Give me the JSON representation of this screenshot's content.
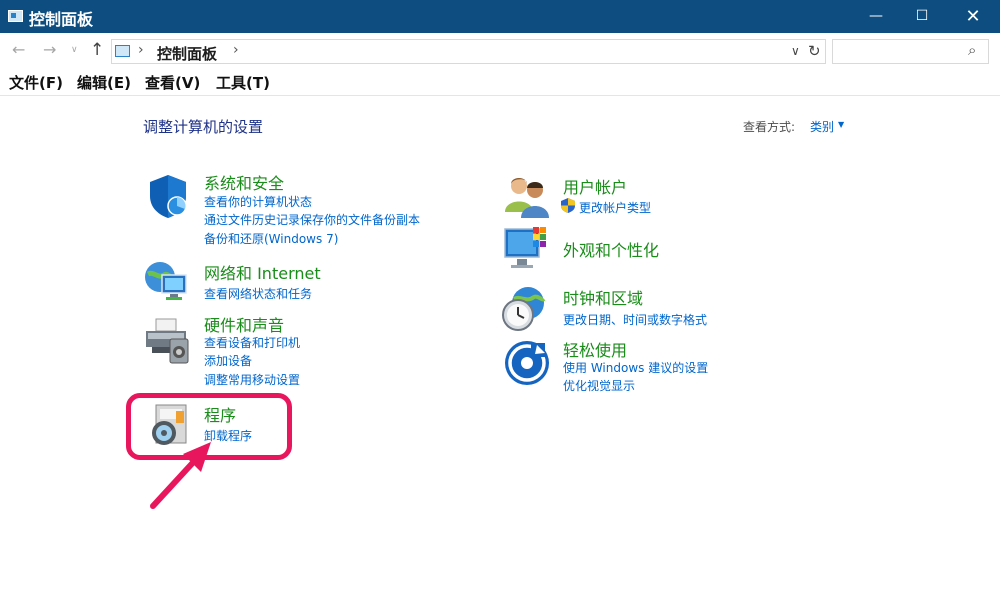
{
  "window": {
    "title": "控制面板"
  },
  "controls": {
    "minimize": "—",
    "maximize": "☐",
    "close": "✕"
  },
  "nav": {
    "back": "←",
    "forward": "→",
    "dropdown": "∨",
    "up": "↑"
  },
  "address": {
    "separator": "›",
    "crumb": "控制面板",
    "dropdown": "∨",
    "refresh": "↻"
  },
  "search": {
    "placeholder": "",
    "icon": "⌕"
  },
  "menu": [
    "文件(F)",
    "编辑(E)",
    "查看(V)",
    "工具(T)"
  ],
  "content": {
    "heading": "调整计算机的设置",
    "viewby_label": "查看方式:",
    "viewby_value": "类别",
    "viewby_caret": "▼"
  },
  "categories": {
    "system": {
      "title": "系统和安全",
      "icon": "shield-icon",
      "links": [
        "查看你的计算机状态",
        "通过文件历史记录保存你的文件备份副本",
        "备份和还原(Windows 7)"
      ]
    },
    "network": {
      "title": "网络和 Internet",
      "icon": "globe-network-icon",
      "links": [
        "查看网络状态和任务"
      ]
    },
    "hardware": {
      "title": "硬件和声音",
      "icon": "printer-icon",
      "links": [
        "查看设备和打印机",
        "添加设备",
        "调整常用移动设置"
      ]
    },
    "programs": {
      "title": "程序",
      "icon": "programs-disc-icon",
      "links": [
        "卸载程序"
      ]
    },
    "users": {
      "title": "用户帐户",
      "icon": "users-icon",
      "links": [
        "更改帐户类型"
      ]
    },
    "appearance": {
      "title": "外观和个性化",
      "icon": "monitor-palette-icon",
      "links": []
    },
    "clock": {
      "title": "时钟和区域",
      "icon": "clock-globe-icon",
      "links": [
        "更改日期、时间或数字格式"
      ]
    },
    "ease": {
      "title": "轻松使用",
      "icon": "ease-of-access-icon",
      "links": [
        "使用 Windows 建议的设置",
        "优化视觉显示"
      ]
    }
  },
  "colors": {
    "titlebar": "#0d4d80",
    "category_title": "#1a8c1a",
    "link": "#0066cc",
    "highlight": "#e8175d"
  }
}
